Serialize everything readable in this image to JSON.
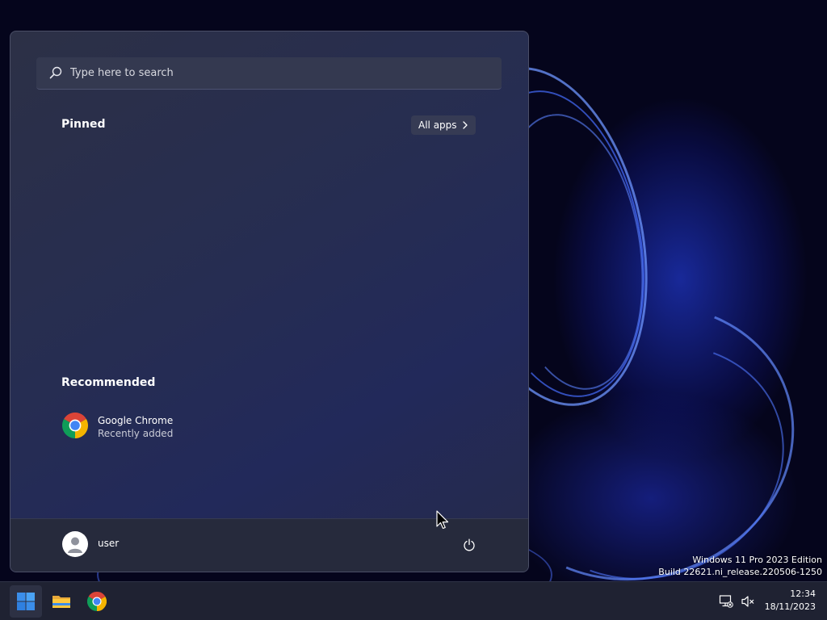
{
  "desktop": {
    "watermark": {
      "edition": "Windows 11 Pro 2023 Edition",
      "build": "Build 22621.ni_release.220506-1250"
    }
  },
  "start_menu": {
    "search": {
      "placeholder": "Type here to search",
      "icon": "search-icon"
    },
    "pinned": {
      "title": "Pinned",
      "all_apps_label": "All apps"
    },
    "recommended": {
      "title": "Recommended",
      "items": [
        {
          "name": "Google Chrome",
          "subtitle": "Recently added",
          "icon": "chrome-icon"
        }
      ]
    },
    "footer": {
      "user_name": "user",
      "power_icon": "power-icon"
    }
  },
  "taskbar": {
    "apps": [
      {
        "name": "Start",
        "icon": "windows-logo-icon"
      },
      {
        "name": "File Explorer",
        "icon": "folder-icon"
      },
      {
        "name": "Google Chrome",
        "icon": "chrome-icon"
      }
    ],
    "tray": {
      "network_icon": "network-disconnected-icon",
      "volume_icon": "volume-muted-icon"
    },
    "clock": {
      "time": "12:34",
      "date": "18/11/2023"
    }
  },
  "colors": {
    "accent": "#3b8eea",
    "menu_background": "#262d52",
    "taskbar_background": "#1f2232"
  }
}
